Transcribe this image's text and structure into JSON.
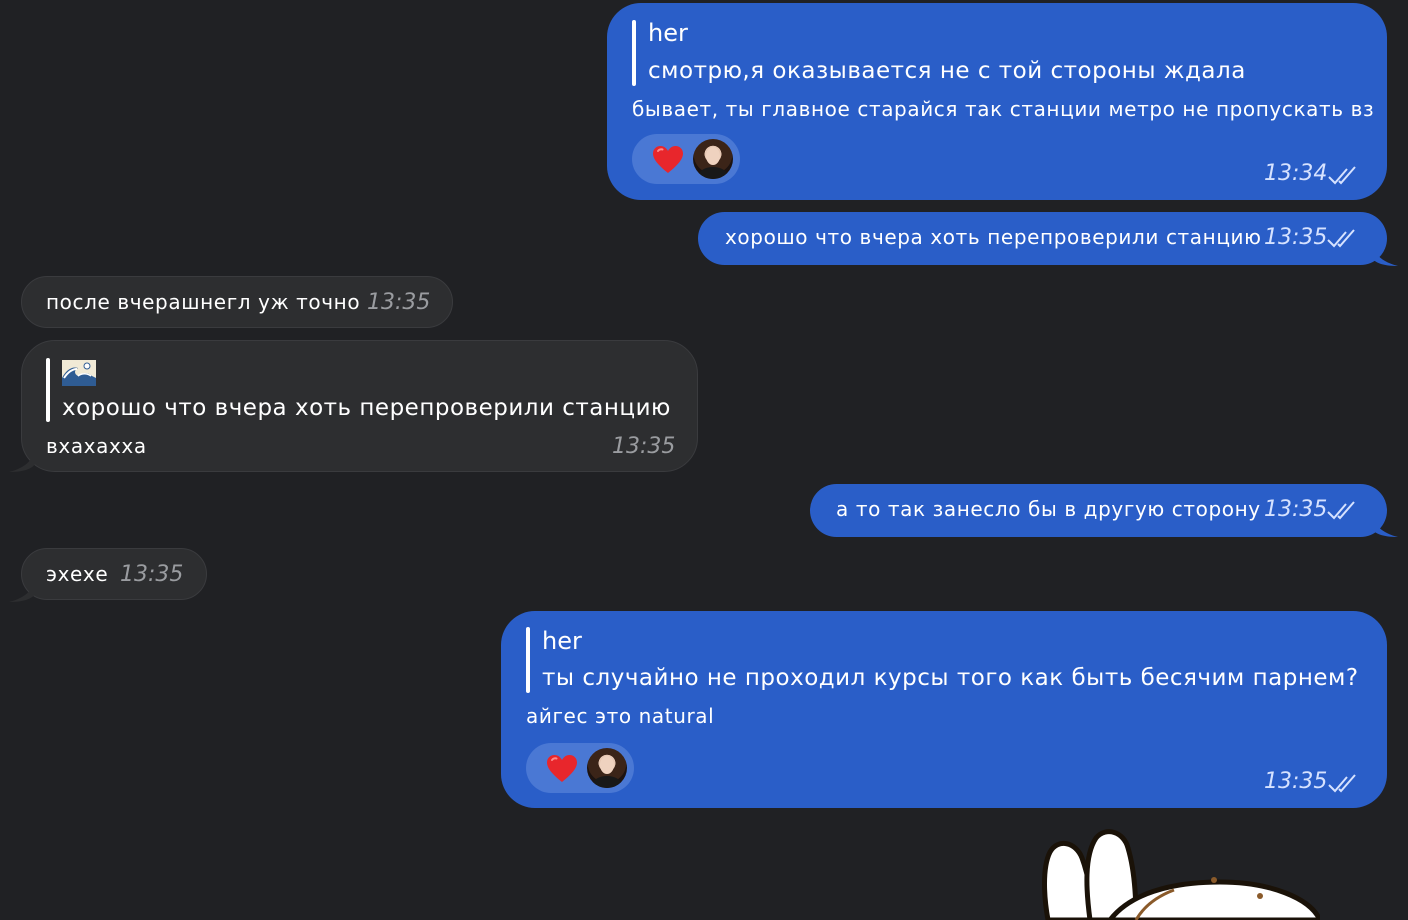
{
  "chat": {
    "messages": [
      {
        "direction": "outgoing",
        "reply_to": {
          "name": "her",
          "text": "смотрю,я оказывается не с той стороны ждала"
        },
        "text": "бывает, ты главное старайся так станции метро не пропускать вз",
        "reactions": {
          "emoji": "heart",
          "reactor": "avatar"
        },
        "time": "13:34",
        "status": "read"
      },
      {
        "direction": "outgoing",
        "text": "хорошо что вчера хоть перепроверили станцию",
        "time": "13:35",
        "status": "read"
      },
      {
        "direction": "incoming",
        "text": "после вчерашнегл уж точно",
        "time": "13:35"
      },
      {
        "direction": "incoming",
        "reply_to": {
          "name": "wave-emoji",
          "text": "хорошо что вчера хоть перепроверили станцию"
        },
        "text": "вхахахха",
        "time": "13:35"
      },
      {
        "direction": "outgoing",
        "text": "а то так занесло бы в другую сторону",
        "time": "13:35",
        "status": "read"
      },
      {
        "direction": "incoming",
        "text": "эхехе",
        "time": "13:35"
      },
      {
        "direction": "outgoing",
        "reply_to": {
          "name": "her",
          "text": "ты случайно не проходил курсы того как быть бесячим парнем?"
        },
        "text": "айгес это natural",
        "reactions": {
          "emoji": "heart",
          "reactor": "avatar"
        },
        "time": "13:35",
        "status": "read"
      }
    ]
  },
  "colors": {
    "background": "#202124",
    "outgoing_bubble": "#2a5ec8",
    "incoming_bubble": "#2d2e30",
    "reaction_pill": "#4a78d4",
    "heart": "#e8262c"
  },
  "icons": {
    "read_status": "double-check-icon",
    "reaction": "heart-icon",
    "sticker": "bunny-ears-sticker"
  }
}
